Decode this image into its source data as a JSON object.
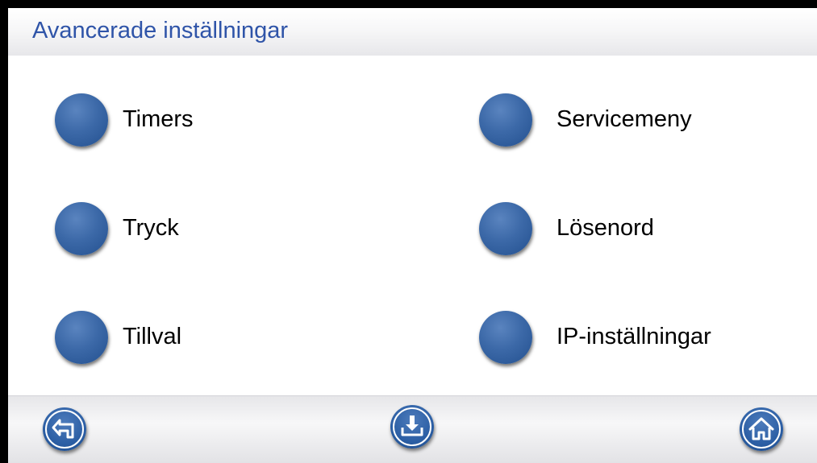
{
  "header": {
    "title": "Avancerade inställningar"
  },
  "menu": {
    "items": [
      {
        "label": "Timers"
      },
      {
        "label": "Tryck"
      },
      {
        "label": "Tillval"
      },
      {
        "label": "Servicemeny"
      },
      {
        "label": "Lösenord"
      },
      {
        "label": "IP-inställningar"
      }
    ]
  },
  "footer": {
    "buttons": [
      {
        "icon": "back-icon"
      },
      {
        "icon": "download-icon"
      },
      {
        "icon": "home-icon"
      }
    ]
  },
  "colors": {
    "title": "#2f54a8",
    "button": "#3c69a8",
    "frame": "#000000"
  }
}
